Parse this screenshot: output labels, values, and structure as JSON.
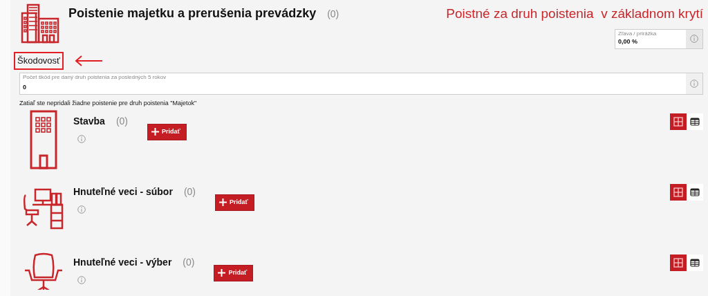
{
  "header": {
    "title": "Poistenie majetku a prerušenia prevádzky",
    "count": "(0)",
    "premium_heading": "Poistné za druh poistenia  v základnom krytí",
    "discount_field": {
      "label": "Zľava / prirážka",
      "value": "0,00 %"
    }
  },
  "claims": {
    "heading": "Škodovosť",
    "highlighted": true,
    "field": {
      "label": "Počet škôd pre daný druh poistenia za posledných 5 rokov",
      "value": "0"
    }
  },
  "empty_note": "Zatiaľ ste nepridali žiadne poistenie pre druh poistenia \"Majetok\"",
  "sections": [
    {
      "kind": "building",
      "title": "Stavba",
      "count": "(0)",
      "add_button": "Pridať",
      "views": [
        {
          "kind": "grid",
          "selected": true
        },
        {
          "kind": "table",
          "selected": false
        }
      ]
    },
    {
      "kind": "desk",
      "title": "Hnuteľné veci - súbor",
      "count": "(0)",
      "add_button": "Pridať",
      "views": [
        {
          "kind": "grid",
          "selected": true
        },
        {
          "kind": "table",
          "selected": false
        }
      ]
    },
    {
      "kind": "chair",
      "title": "Hnuteľné veci - výber",
      "count": "(0)",
      "add_button": "Pridať",
      "views": [
        {
          "kind": "grid",
          "selected": true
        },
        {
          "kind": "table",
          "selected": false
        }
      ]
    }
  ]
}
